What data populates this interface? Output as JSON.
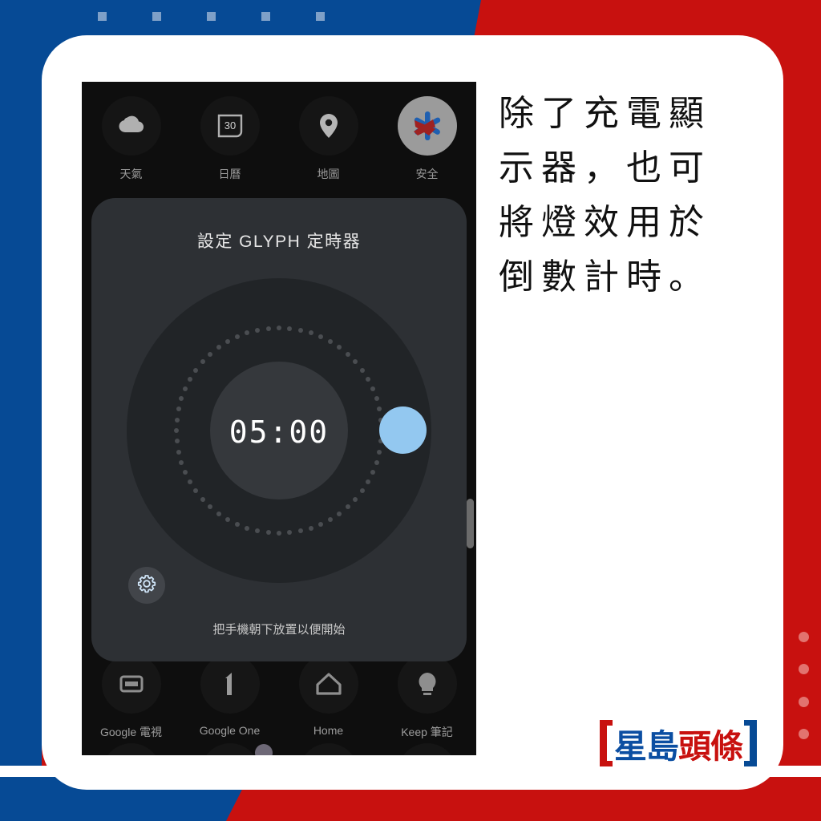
{
  "palette": {
    "blue": "#064a95",
    "red": "#c8110f",
    "white": "#ffffff",
    "accent_knob": "#93c8f0",
    "dot_blue": "#7ea0c8",
    "dot_red": "#e2736f",
    "phone_bg": "#0e0e0e",
    "card_bg": "#2d3034"
  },
  "caption": {
    "text": "除了充電顯示器，也可將燈效用於倒數計時。"
  },
  "logo": {
    "blue_text": "星島",
    "red_text": "頭條"
  },
  "phone": {
    "top_apps": [
      {
        "label": "天氣",
        "icon": "cloud-icon"
      },
      {
        "label": "日曆",
        "icon": "calendar-30-icon"
      },
      {
        "label": "地圖",
        "icon": "map-pin-icon"
      },
      {
        "label": "安全",
        "icon": "safety-asterisk-icon"
      }
    ],
    "bottom_apps": [
      {
        "label": "Google 電視",
        "icon": "google-tv-icon"
      },
      {
        "label": "Google One",
        "icon": "google-one-icon"
      },
      {
        "label": "Home",
        "icon": "home-icon"
      },
      {
        "label": "Keep 筆記",
        "icon": "keep-bulb-icon"
      }
    ],
    "glyph_timer": {
      "title": "設定 GLYPH 定時器",
      "timer_value": "05:00",
      "hint": "把手機朝下放置以便開始",
      "settings_icon": "gear-icon",
      "ring_dot_count": 60
    }
  },
  "decor": {
    "top_squares": [
      122,
      190,
      258,
      326,
      394
    ],
    "right_circles": [
      788,
      828,
      869,
      909
    ]
  }
}
